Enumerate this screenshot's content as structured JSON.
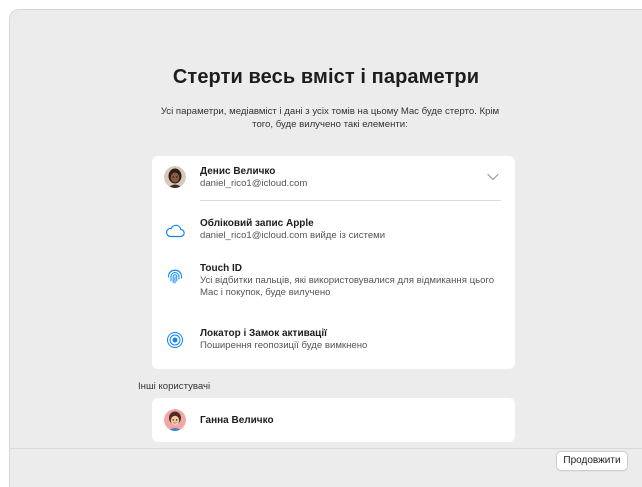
{
  "header": {
    "title": "Стерти весь вміст і параметри",
    "subtitle": "Усі параметри, медіавміст і дані з усіх томів на цьому Mac буде стерто. Крім того, буде вилучено такі елементи:"
  },
  "account": {
    "name": "Денис Величко",
    "email": "daniel_rico1@icloud.com"
  },
  "items": [
    {
      "icon": "icloud-icon",
      "title": "Обліковий запис Apple",
      "description": "daniel_rico1@icloud.com вийде із системи"
    },
    {
      "icon": "fingerprint-icon",
      "title": "Touch ID",
      "description": "Усі відбитки пальців, які використовувалися для відмикання цього Mac і покупок, буде вилучено"
    },
    {
      "icon": "find-my-icon",
      "title": "Локатор і Замок активації",
      "description": "Поширення геопозиції буде вимкнено"
    }
  ],
  "others": {
    "label": "Інші користувачі",
    "users": [
      {
        "name": "Ганна Величко"
      }
    ]
  },
  "footer": {
    "continue_label": "Продовжити"
  },
  "colors": {
    "accent": "#0a84ff",
    "background": "#ececec",
    "card": "#ffffff"
  }
}
